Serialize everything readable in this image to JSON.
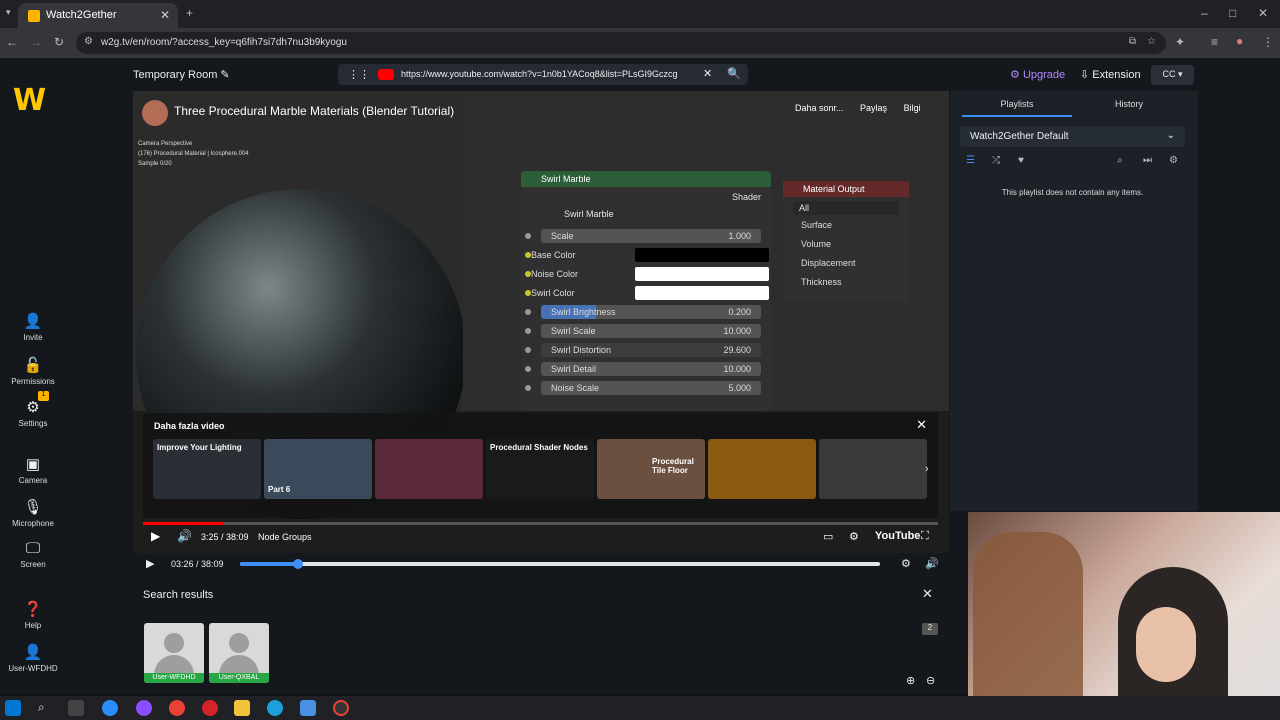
{
  "browser": {
    "tab_title": "Watch2Gether",
    "url": "w2g.tv/en/room/?access_key=q6fih7si7dh7nu3b9kyogu"
  },
  "header": {
    "room_title": "Temporary Room",
    "media_url": "https://www.youtube.com/watch?v=1n0b1YACoq8&list=PLsGI9Gczcg",
    "upgrade_label": "Upgrade",
    "extension_label": "Extension"
  },
  "leftnav": {
    "items": [
      {
        "label": "Invite",
        "icon": "person-plus-icon"
      },
      {
        "label": "Permissions",
        "icon": "lock-icon"
      },
      {
        "label": "Settings",
        "icon": "gear-icon"
      },
      {
        "label": "Camera",
        "icon": "camera-icon"
      },
      {
        "label": "Microphone",
        "icon": "microphone-icon"
      },
      {
        "label": "Screen",
        "icon": "monitor-icon"
      },
      {
        "label": "Help",
        "icon": "help-icon"
      },
      {
        "label": "User-WFDHD",
        "icon": "user-icon"
      }
    ],
    "settings_badge": "1"
  },
  "video": {
    "title": "Three Procedural Marble Materials (Blender Tutorial)",
    "yt_later": "Daha sonr...",
    "yt_share": "Paylaş",
    "yt_info": "Bilgi",
    "viewport_info": [
      "Camera Perspective",
      "(176) Procedural Material | Icosphere.004",
      "Sample 0/20"
    ],
    "node_swirl": {
      "title": "Swirl Marble",
      "shader": "Shader",
      "subtitle": "Swirl Marble",
      "rows": [
        {
          "label": "Scale",
          "value": "1.000"
        },
        {
          "label": "Base Color",
          "value": ""
        },
        {
          "label": "Noise Color",
          "value": ""
        },
        {
          "label": "Swirl Color",
          "value": ""
        },
        {
          "label": "Swirl Brightness",
          "value": "0.200"
        },
        {
          "label": "Swirl Scale",
          "value": "10.000"
        },
        {
          "label": "Swirl Distortion",
          "value": "29.600"
        },
        {
          "label": "Swirl Detail",
          "value": "10.000"
        },
        {
          "label": "Noise Scale",
          "value": "5.000"
        }
      ]
    },
    "node_output": {
      "title": "Material Output",
      "target": "All",
      "rows": [
        "Surface",
        "Volume",
        "Displacement",
        "Thickness"
      ]
    },
    "more_videos": {
      "title": "Daha fazla video",
      "thumbs": [
        {
          "label": "Improve Your Lighting",
          "color": "#2a2f36"
        },
        {
          "label": "Part 6",
          "color": "#3b4a5a"
        },
        {
          "label": "",
          "color": "#5a2a3a"
        },
        {
          "label": "Procedural Shader Nodes",
          "color": "#1a1a1a"
        },
        {
          "label": "Procedural Tile Floor",
          "color": "#6b5040"
        },
        {
          "label": "",
          "color": "#8a5a10"
        },
        {
          "label": "",
          "color": "#3a3a3a"
        }
      ]
    },
    "yt_time": "3:25 / 38:09",
    "yt_chapter": "Node Groups",
    "yt_brand": "YouTube"
  },
  "w2g_player": {
    "time": "03:26 / 38:09",
    "progress": 0.09
  },
  "search": {
    "title": "Search results",
    "users": [
      "User-WFDHD",
      "User-QXBAL"
    ],
    "count_badge": "2"
  },
  "right_panel": {
    "tab_playlists": "Playlists",
    "tab_history": "History",
    "playlist_name": "Watch2Gether Default",
    "empty_msg": "This playlist does not contain any items."
  },
  "colors": {
    "accent": "#3d8ef5",
    "upgrade": "#b388ff",
    "logo": "#ffc800",
    "user_badge": "#27a844"
  }
}
